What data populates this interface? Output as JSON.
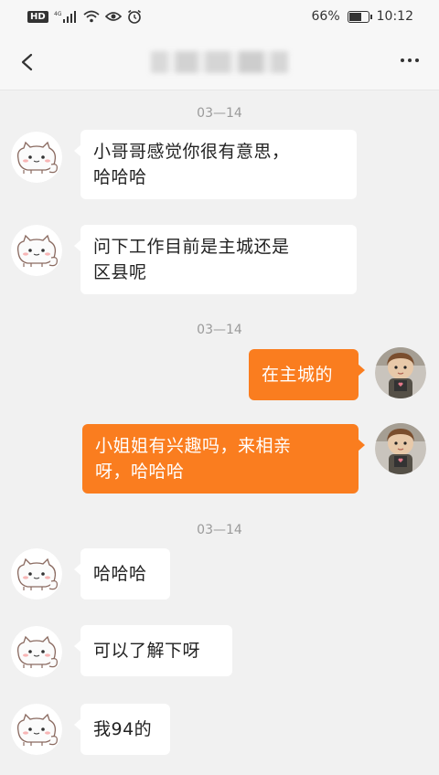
{
  "status": {
    "left_icons": [
      "hd-badge",
      "signal-4g-icon",
      "wifi-icon",
      "eye-icon",
      "alarm-icon"
    ],
    "hd_label": "HD",
    "battery_percent": "66%",
    "battery_level": 0.66,
    "time": "10:12"
  },
  "nav": {
    "back_icon": "chevron-left-icon",
    "title_blurred": true,
    "more_icon": "more-dots-icon"
  },
  "colors": {
    "outgoing": "#fa7d1f",
    "incoming": "#ffffff",
    "background": "#f1f1f1"
  },
  "chat": {
    "date1": "03—14",
    "m1": {
      "line1": "小哥哥感觉你很有意思，",
      "line2": "哈哈哈"
    },
    "m2": {
      "line1": "问下工作目前是主城还是",
      "line2": "区县呢"
    },
    "date2": "03—14",
    "m3": {
      "line1": "在主城的"
    },
    "m4": {
      "line1": "小姐姐有兴趣吗，来相亲",
      "line2": "呀，哈哈哈"
    },
    "date3": "03—14",
    "m5": {
      "line1": "哈哈哈"
    },
    "m6": {
      "line1": "可以了解下呀"
    },
    "m7": {
      "line1": "我94的"
    }
  }
}
